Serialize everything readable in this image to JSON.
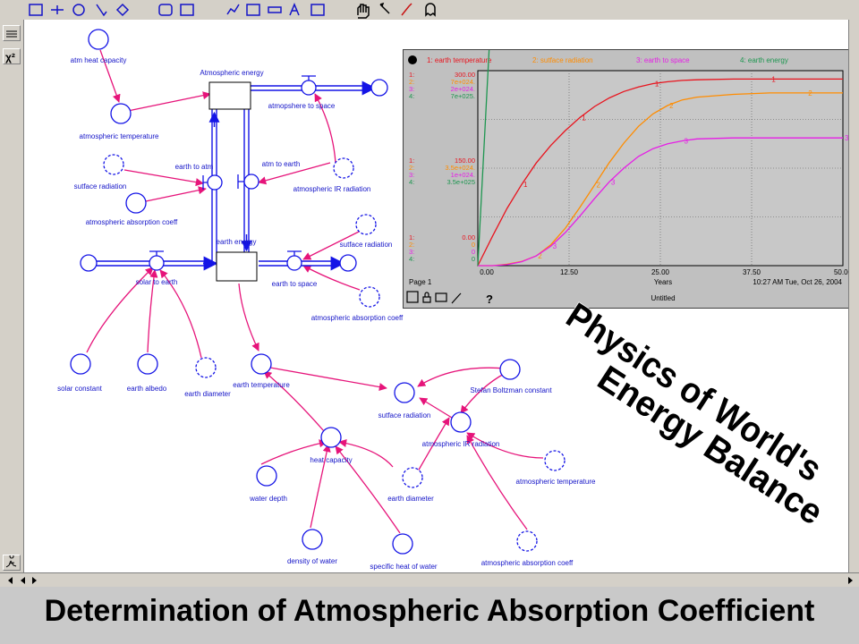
{
  "caption": "Determination of Atmospheric Absorption Coefficient",
  "overlay_title": {
    "line1": "Physics of World's",
    "line2": "Energy Balance"
  },
  "toolbar": {
    "icons": [
      "stock-tool-icon",
      "flow-tool-icon",
      "converter-tool-icon",
      "connector-tool-icon",
      "decision-tool-icon",
      "module-tool-icon",
      "sector-tool-icon",
      "graph-tool-icon",
      "table-tool-icon",
      "numeric-display-tool-icon",
      "text-tool-icon",
      "picture-tool-icon",
      "hand-tool-icon",
      "paintbrush-tool-icon",
      "dynamite-tool-icon",
      "ghost-tool-icon"
    ]
  },
  "diagram": {
    "stocks": {
      "atmospheric_energy": "Atmospheric energy",
      "earth_energy": "earth energy"
    },
    "flows": {
      "atmosphere_to_space": "atmopshere to space",
      "earth_to_atm": "earth to atm",
      "atm_to_earth": "atm to earth",
      "solar_to_earth": "solar to earth",
      "earth_to_space": "earth to space"
    },
    "converters": {
      "atm_heat_capacity": "atm heat capacity",
      "atmospheric_temperature": "atmospheric temperature",
      "sutface_radiation_1": "sutface radiation",
      "atmospheric_absorption_coeff_1": "atmospheric absorption coeff",
      "atmospheric_ir_radiation_1": "atmospheric IR radiation",
      "sutface_radiation_2": "sutface radiation",
      "atmospheric_absorption_coeff_2": "atmospheric absorption coeff",
      "solar_constant": "solar constant",
      "earth_albedo": "earth albedo",
      "earth_diameter_1": "earth diameter",
      "earth_temperature": "earth temperature",
      "sutface_radiation_3": "sutface radiation",
      "stefan_boltzman_constant": "Stefan Boltzman constant",
      "atmospheric_ir_radiation_2": "atmospheric IR radiation",
      "heat_capacity": "heat capacity",
      "water_depth": "water depth",
      "earth_diameter_2": "earth diameter",
      "atmospheric_temperature_2": "atmospheric temperature",
      "density_of_water": "density of water",
      "specific_heat_of_water": "specific heat of water",
      "atmospheric_absorption_coeff_3": "atmospheric absorption coeff"
    }
  },
  "graph": {
    "page_label": "Page 1",
    "title_label": "Untitled",
    "x_axis_label": "Years",
    "timestamp": "10:27 AM   Tue, Oct 26, 2004",
    "help_label": "?",
    "legend": [
      {
        "num": "1",
        "text": "1: earth temperature",
        "color": "#e8141e"
      },
      {
        "num": "2",
        "text": "2: sutface radiation",
        "color": "#ff8c00"
      },
      {
        "num": "3",
        "text": "3: earth to space",
        "color": "#e61ee6"
      },
      {
        "num": "4",
        "text": "4: earth energy",
        "color": "#1e9650"
      }
    ],
    "scale_top": [
      "1:",
      "300.00",
      "2:",
      "7e+024.",
      "3:",
      "2e+024.",
      "4:",
      "7e+025."
    ],
    "scale_mid": [
      "1:",
      "150.00",
      "2:",
      "3.5e+024.",
      "3:",
      "1e+024.",
      "4:",
      "3.5e+025"
    ],
    "scale_bottom": [
      "1:",
      "0.00",
      "2:",
      "0",
      "3:",
      "0",
      "4:",
      "0"
    ]
  },
  "chart_data": {
    "type": "line",
    "xlabel": "Years",
    "xlim": [
      0,
      50
    ],
    "xticks": [
      "0.00",
      "12.50",
      "25.00",
      "37.50",
      "50.00"
    ],
    "series": [
      {
        "name": "1: earth temperature",
        "color": "#e8141e",
        "x": [
          0,
          2,
          4,
          6,
          8,
          10,
          12,
          14,
          16,
          18,
          20,
          22,
          24,
          26,
          28,
          30,
          35,
          40,
          45,
          50
        ],
        "y": [
          0,
          45,
          88,
          125,
          158,
          185,
          208,
          228,
          245,
          258,
          268,
          275,
          280,
          283,
          285,
          286,
          287,
          287,
          287,
          287
        ]
      },
      {
        "name": "2: sutface radiation",
        "color": "#ff8c00",
        "x": [
          0,
          2,
          4,
          6,
          8,
          10,
          12,
          14,
          16,
          18,
          20,
          22,
          24,
          26,
          28,
          30,
          35,
          40,
          45,
          50
        ],
        "y": [
          0,
          0,
          5e+22,
          1.5e+23,
          3.5e+23,
          7.5e+23,
          1.35e+24,
          2.1e+24,
          2.9e+24,
          3.7e+24,
          4.4e+24,
          5e+24,
          5.45e+24,
          5.75e+24,
          5.95e+24,
          6.05e+24,
          6.15e+24,
          6.2e+24,
          6.2e+24,
          6.2e+24
        ]
      },
      {
        "name": "3: earth to space",
        "color": "#e61ee6",
        "x": [
          0,
          2,
          4,
          6,
          8,
          10,
          12,
          14,
          16,
          18,
          20,
          22,
          24,
          26,
          28,
          30,
          35,
          40,
          45,
          50
        ],
        "y": [
          0,
          0,
          1e+22,
          4e+22,
          1e+23,
          2e+23,
          3.4e+23,
          5.1e+23,
          6.9e+23,
          8.6e+23,
          1e+24,
          1.12e+24,
          1.2e+24,
          1.25e+24,
          1.28e+24,
          1.3e+24,
          1.31e+24,
          1.31e+24,
          1.31e+24,
          1.31e+24
        ]
      },
      {
        "name": "4: earth energy",
        "color": "#1e9650",
        "x": [
          0,
          2,
          4,
          6,
          8,
          10,
          12,
          14,
          16,
          18,
          20,
          22,
          24,
          26,
          28,
          30,
          35,
          40,
          45,
          50
        ],
        "y": [
          0,
          1e+26,
          1.9e+26,
          2.7e+26,
          3.4e+26,
          4.1e+26,
          4.7e+26,
          5.2e+26,
          5.6e+26,
          5.95e+26,
          6.2e+26,
          6.4e+26,
          6.55e+26,
          6.65e+26,
          6.72e+26,
          6.76e+26,
          6.8e+26,
          6.8e+26,
          6.8e+26,
          6.8e+26
        ]
      }
    ],
    "ylim_series": [
      [
        0,
        300
      ],
      [
        0,
        7e+24
      ],
      [
        0,
        2e+24
      ],
      [
        0,
        7e+25
      ]
    ]
  },
  "colors": {
    "diagram_blue": "#1414e6",
    "connector_pink": "#e6147a",
    "caption_bg": "#c9c9c9"
  }
}
